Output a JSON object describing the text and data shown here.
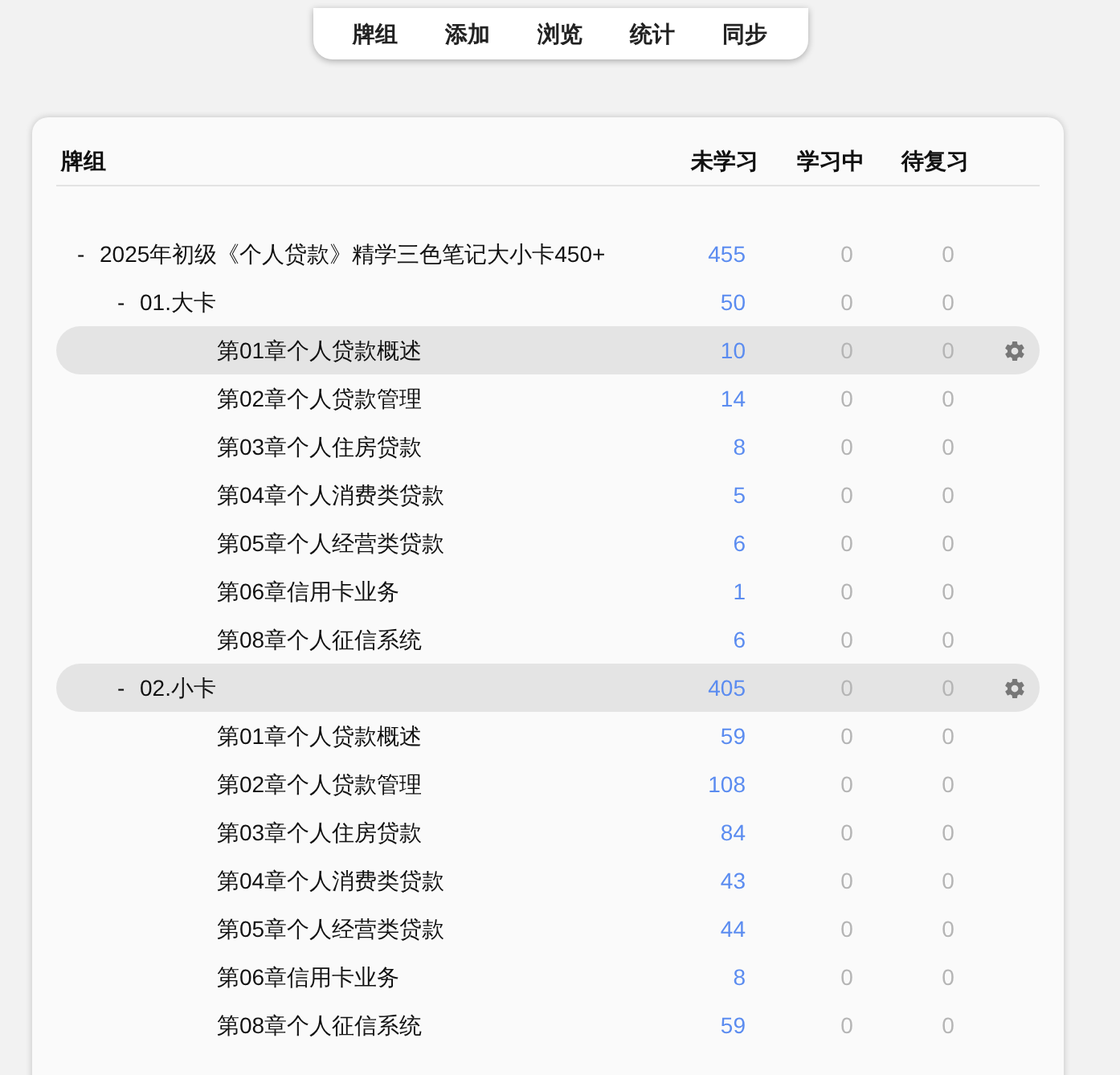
{
  "nav": [
    {
      "label": "牌组"
    },
    {
      "label": "添加"
    },
    {
      "label": "浏览"
    },
    {
      "label": "统计"
    },
    {
      "label": "同步"
    }
  ],
  "table": {
    "columns": [
      "牌组",
      "未学习",
      "学习中",
      "待复习"
    ],
    "rows": [
      {
        "name": "2025年初级《个人贷款》精学三色笔记大小卡450+",
        "expander": "-",
        "new": "455",
        "learning": "0",
        "review": "0",
        "selected": false,
        "children": [
          {
            "name": "01.大卡",
            "expander": "-",
            "new": "50",
            "learning": "0",
            "review": "0",
            "selected": false,
            "children": [
              {
                "name": "第01章个人贷款概述",
                "new": "10",
                "learning": "0",
                "review": "0",
                "selected": true
              },
              {
                "name": "第02章个人贷款管理",
                "new": "14",
                "learning": "0",
                "review": "0",
                "selected": false
              },
              {
                "name": "第03章个人住房贷款",
                "new": "8",
                "learning": "0",
                "review": "0",
                "selected": false
              },
              {
                "name": "第04章个人消费类贷款",
                "new": "5",
                "learning": "0",
                "review": "0",
                "selected": false
              },
              {
                "name": "第05章个人经营类贷款",
                "new": "6",
                "learning": "0",
                "review": "0",
                "selected": false
              },
              {
                "name": "第06章信用卡业务",
                "new": "1",
                "learning": "0",
                "review": "0",
                "selected": false
              },
              {
                "name": "第08章个人征信系统",
                "new": "6",
                "learning": "0",
                "review": "0",
                "selected": false
              }
            ]
          },
          {
            "name": "02.小卡",
            "expander": "-",
            "new": "405",
            "learning": "0",
            "review": "0",
            "selected": true,
            "children": [
              {
                "name": "第01章个人贷款概述",
                "new": "59",
                "learning": "0",
                "review": "0",
                "selected": false
              },
              {
                "name": "第02章个人贷款管理",
                "new": "108",
                "learning": "0",
                "review": "0",
                "selected": false
              },
              {
                "name": "第03章个人住房贷款",
                "new": "84",
                "learning": "0",
                "review": "0",
                "selected": false
              },
              {
                "name": "第04章个人消费类贷款",
                "new": "43",
                "learning": "0",
                "review": "0",
                "selected": false
              },
              {
                "name": "第05章个人经营类贷款",
                "new": "44",
                "learning": "0",
                "review": "0",
                "selected": false
              },
              {
                "name": "第06章信用卡业务",
                "new": "8",
                "learning": "0",
                "review": "0",
                "selected": false
              },
              {
                "name": "第08章个人征信系统",
                "new": "59",
                "learning": "0",
                "review": "0",
                "selected": false
              }
            ]
          }
        ]
      }
    ]
  }
}
